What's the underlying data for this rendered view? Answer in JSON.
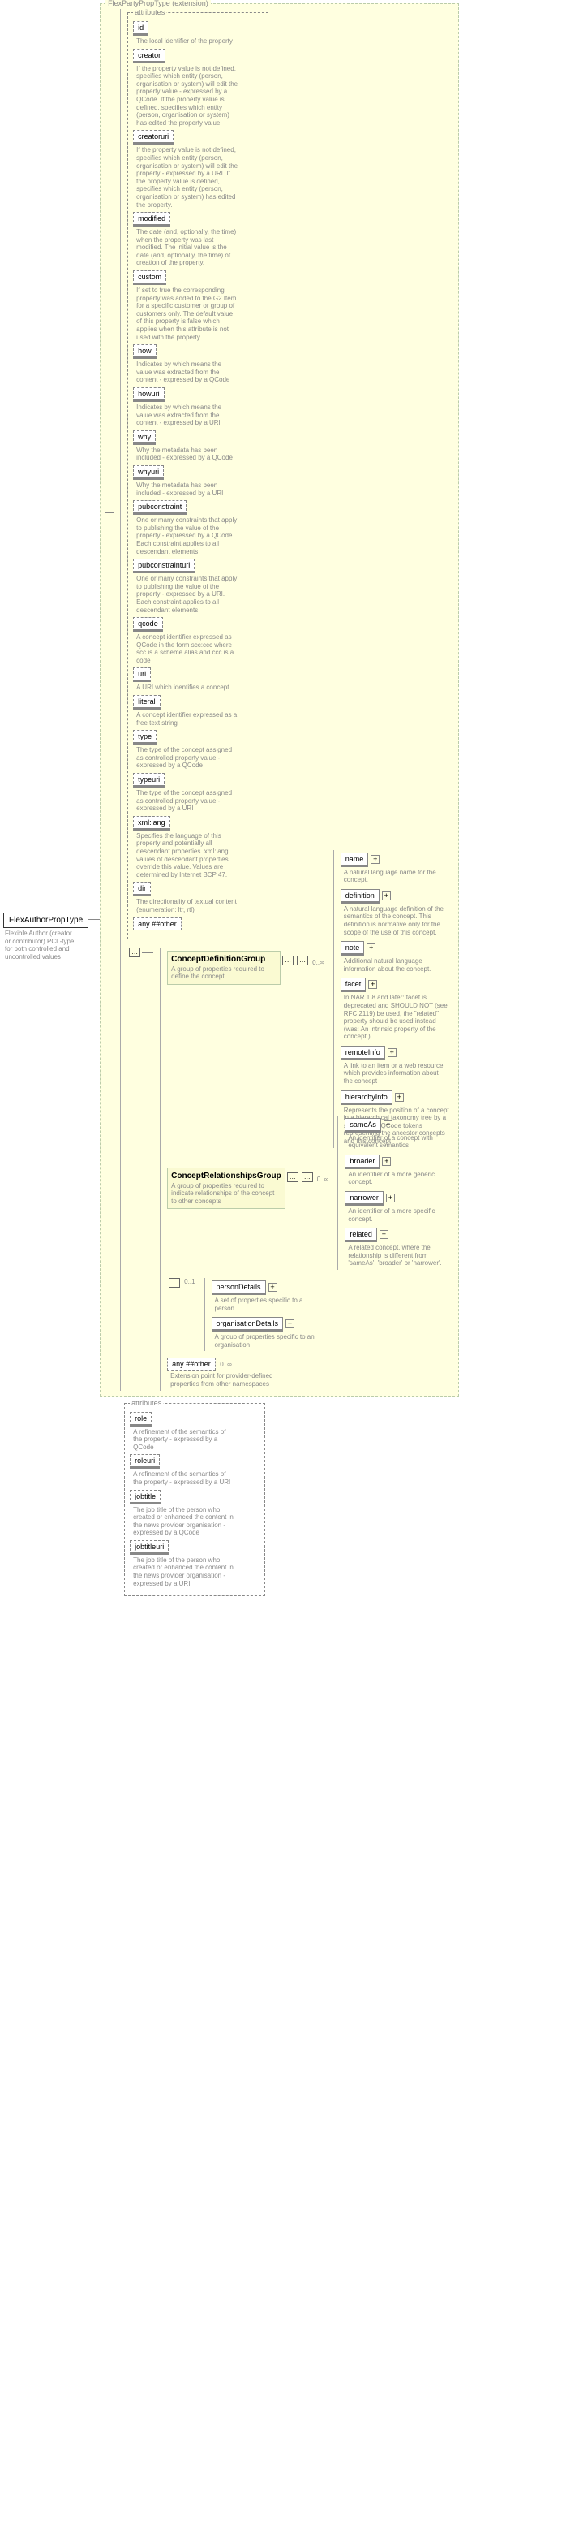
{
  "root": {
    "name": "FlexAuthorPropType",
    "sub": "Flexible Author (creator or contributor) PCL-type for both controlled and uncontrolled values"
  },
  "ext": {
    "title": "FlexPartyPropType (extension)"
  },
  "attributes": {
    "label": "attributes",
    "items": [
      {
        "name": "id",
        "desc": "The local identifier of the property"
      },
      {
        "name": "creator",
        "desc": "If the property value is not defined, specifies which entity (person, organisation or system) will edit the property value - expressed by a QCode. If the property value is defined, specifies which entity (person, organisation or system) has edited the property value."
      },
      {
        "name": "creatoruri",
        "desc": "If the property value is not defined, specifies which entity (person, organisation or system) will edit the property - expressed by a URI. If the property value is defined, specifies which entity (person, organisation or system) has edited the property."
      },
      {
        "name": "modified",
        "desc": "The date (and, optionally, the time) when the property was last modified. The initial value is the date (and, optionally, the time) of creation of the property."
      },
      {
        "name": "custom",
        "desc": "If set to true the corresponding property was added to the G2 Item for a specific customer or group of customers only. The default value of this property is false which applies when this attribute is not used with the property."
      },
      {
        "name": "how",
        "desc": "Indicates by which means the value was extracted from the content - expressed by a QCode"
      },
      {
        "name": "howuri",
        "desc": "Indicates by which means the value was extracted from the content - expressed by a URI"
      },
      {
        "name": "why",
        "desc": "Why the metadata has been included - expressed by a QCode"
      },
      {
        "name": "whyuri",
        "desc": "Why the metadata has been included - expressed by a URI"
      },
      {
        "name": "pubconstraint",
        "desc": "One or many constraints that apply to publishing the value of the property - expressed by a QCode. Each constraint applies to all descendant elements."
      },
      {
        "name": "pubconstrainturi",
        "desc": "One or many constraints that apply to publishing the value of the property - expressed by a URI. Each constraint applies to all descendant elements."
      },
      {
        "name": "qcode",
        "desc": "A concept identifier expressed as QCode in the form scc:ccc where scc is a scheme alias and ccc is a code"
      },
      {
        "name": "uri",
        "desc": "A URI which identifies a concept"
      },
      {
        "name": "literal",
        "desc": "A concept identifier expressed as a free text string"
      },
      {
        "name": "type",
        "desc": "The type of the concept assigned as controlled property value - expressed by a QCode"
      },
      {
        "name": "typeuri",
        "desc": "The type of the concept assigned as controlled property value - expressed by a URI"
      },
      {
        "name": "xml:lang",
        "desc": "Specifies the language of this property and potentially all descendant properties. xml:lang values of descendant properties override this value. Values are determined by Internet BCP 47."
      },
      {
        "name": "dir",
        "desc": "The directionality of textual content (enumeration: ltr, rtl)"
      }
    ],
    "anyOther": "any ##other"
  },
  "groups": {
    "cdg": {
      "name": "ConceptDefinitionGroup",
      "desc": "A group of properties required to define the concept"
    },
    "crg": {
      "name": "ConceptRelationshipsGroup",
      "desc": "A group of properties required to indicate relationships of the concept to other concepts"
    }
  },
  "cdgChildren": [
    {
      "name": "name",
      "desc": "A natural language name for the concept."
    },
    {
      "name": "definition",
      "desc": "A natural language definition of the semantics of the concept. This definition is normative only for the scope of the use of this concept."
    },
    {
      "name": "note",
      "desc": "Additional natural language information about the concept."
    },
    {
      "name": "facet",
      "desc": "In NAR 1.8 and later: facet is deprecated and SHOULD NOT (see RFC 2119) be used, the \"related\" property should be used instead (was: An intrinsic property of the concept.)"
    },
    {
      "name": "remoteInfo",
      "desc": "A link to an item or a web resource which provides information about the concept"
    },
    {
      "name": "hierarchyInfo",
      "desc": "Represents the position of a concept in a hierarchical taxonomy tree by a sequence of QCode tokens representing the ancestor concepts and this concept"
    }
  ],
  "crgChildren": [
    {
      "name": "sameAs",
      "desc": "An identifier of a concept with equivalent semantics"
    },
    {
      "name": "broader",
      "desc": "An identifier of a more generic concept."
    },
    {
      "name": "narrower",
      "desc": "An identifier of a more specific concept."
    },
    {
      "name": "related",
      "desc": "A related concept, where the relationship is different from 'sameAs', 'broader' or 'narrower'."
    }
  ],
  "choice": [
    {
      "name": "personDetails",
      "desc": "A set of properties specific to a person"
    },
    {
      "name": "organisationDetails",
      "desc": "A group of properties specific to an organisation"
    }
  ],
  "extPoint": {
    "name": "any ##other",
    "desc": "Extension point for provider-defined properties from other namespaces",
    "occ": "0..∞"
  },
  "attributes2": {
    "label": "attributes",
    "items": [
      {
        "name": "role",
        "desc": "A refinement of the semantics of the property - expressed by a QCode"
      },
      {
        "name": "roleuri",
        "desc": "A refinement of the semantics of the property - expressed by a URI"
      },
      {
        "name": "jobtitle",
        "desc": "The job title of the person who created or enhanced the content in the news provider organisation - expressed by a QCode"
      },
      {
        "name": "jobtitleuri",
        "desc": "The job title of the person who created or enhanced the content in the news provider organisation - expressed by a URI"
      }
    ]
  },
  "occ": "0..∞",
  "occ1": "0..1",
  "seq": "…"
}
